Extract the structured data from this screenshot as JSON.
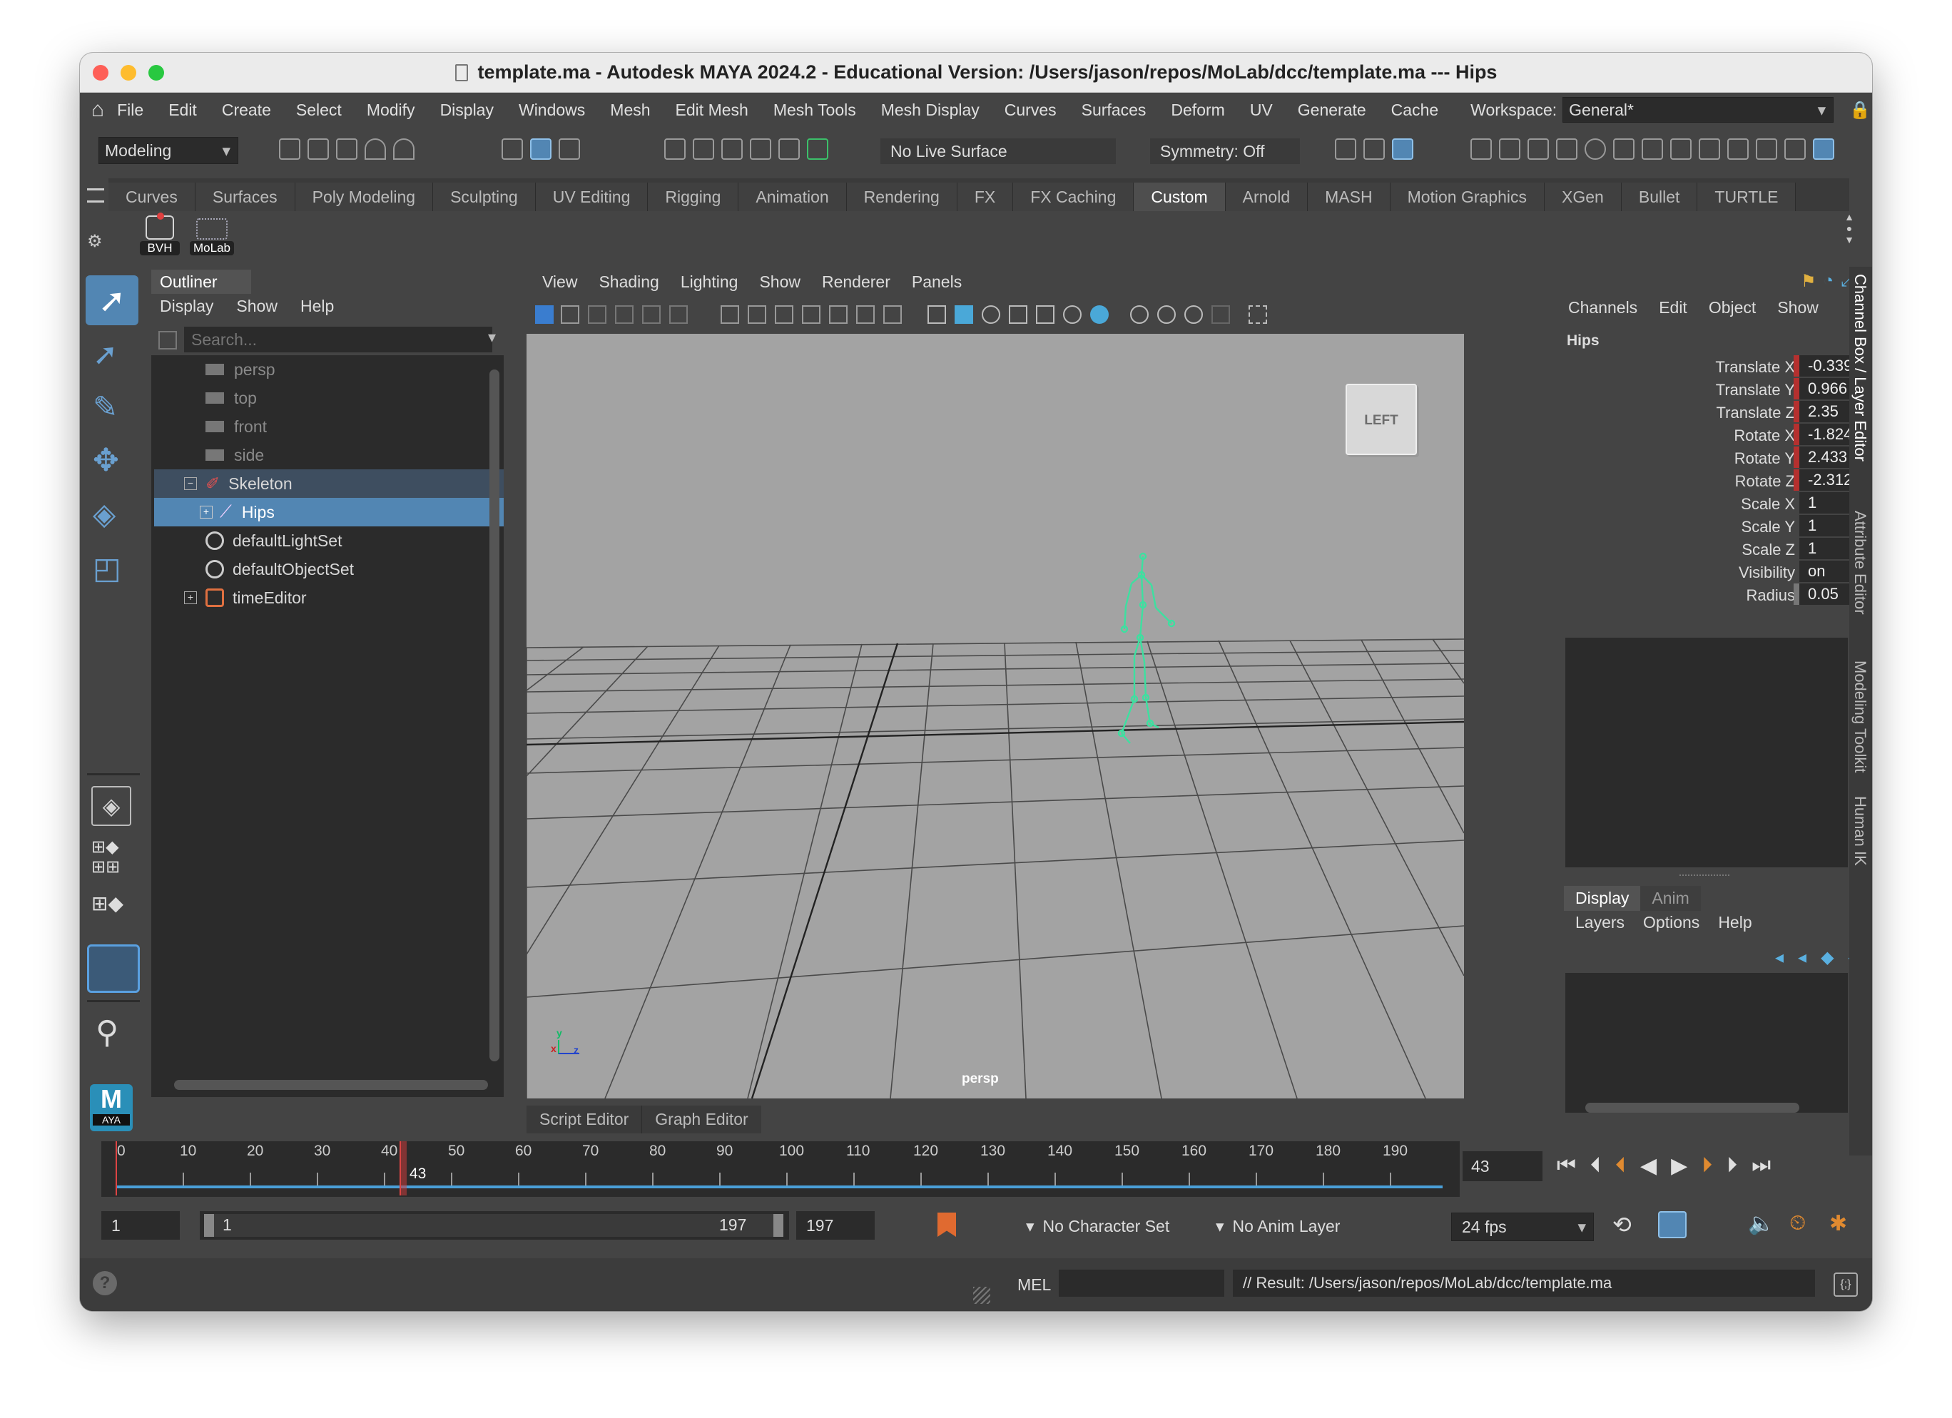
{
  "window": {
    "title": "template.ma - Autodesk MAYA 2024.2 - Educational Version: /Users/jason/repos/MoLab/dcc/template.ma   ---   Hips"
  },
  "menubar": {
    "items": [
      "File",
      "Edit",
      "Create",
      "Select",
      "Modify",
      "Display",
      "Windows",
      "Mesh",
      "Edit Mesh",
      "Mesh Tools",
      "Mesh Display",
      "Curves",
      "Surfaces",
      "Deform",
      "UV",
      "Generate",
      "Cache"
    ],
    "workspace_label": "Workspace:",
    "workspace_value": "General*"
  },
  "statusline": {
    "mode": "Modeling",
    "live_surface": "No Live Surface",
    "symmetry": "Symmetry: Off"
  },
  "shelf": {
    "tabs": [
      "Curves",
      "Surfaces",
      "Poly Modeling",
      "Sculpting",
      "UV Editing",
      "Rigging",
      "Animation",
      "Rendering",
      "FX",
      "FX Caching",
      "Custom",
      "Arnold",
      "MASH",
      "Motion Graphics",
      "XGen",
      "Bullet",
      "TURTLE"
    ],
    "active_tab": "Custom",
    "buttons": [
      "BVH",
      "MoLab"
    ]
  },
  "outliner": {
    "title": "Outliner",
    "menu": [
      "Display",
      "Show",
      "Help"
    ],
    "search_placeholder": "Search...",
    "items": [
      {
        "label": "persp",
        "icon": "camera-icon",
        "dim": true,
        "selected": false
      },
      {
        "label": "top",
        "icon": "camera-icon",
        "dim": true,
        "selected": false
      },
      {
        "label": "front",
        "icon": "camera-icon",
        "dim": true,
        "selected": false
      },
      {
        "label": "side",
        "icon": "camera-icon",
        "dim": true,
        "selected": false
      },
      {
        "label": "Skeleton",
        "icon": "joint-group-icon",
        "dim": false,
        "selected": "parent"
      },
      {
        "label": "Hips",
        "icon": "joint-icon",
        "dim": false,
        "selected": true
      },
      {
        "label": "defaultLightSet",
        "icon": "set-icon",
        "dim": false,
        "selected": false
      },
      {
        "label": "defaultObjectSet",
        "icon": "set-icon",
        "dim": false,
        "selected": false
      },
      {
        "label": "timeEditor",
        "icon": "time-editor-icon",
        "dim": false,
        "selected": false
      }
    ]
  },
  "viewport": {
    "menu": [
      "View",
      "Shading",
      "Lighting",
      "Show",
      "Renderer",
      "Panels"
    ],
    "view_cube": "LEFT",
    "camera": "persp",
    "bottom_tabs": [
      "Script Editor",
      "Graph Editor"
    ]
  },
  "channelbox": {
    "menu": [
      "Channels",
      "Edit",
      "Object",
      "Show"
    ],
    "node": "Hips",
    "channels": [
      {
        "label": "Translate X",
        "value": "-0.339",
        "keyed": true
      },
      {
        "label": "Translate Y",
        "value": "0.966",
        "keyed": true
      },
      {
        "label": "Translate Z",
        "value": "2.35",
        "keyed": true
      },
      {
        "label": "Rotate X",
        "value": "-1.824",
        "keyed": true
      },
      {
        "label": "Rotate Y",
        "value": "2.433",
        "keyed": true
      },
      {
        "label": "Rotate Z",
        "value": "-2.312",
        "keyed": true
      },
      {
        "label": "Scale X",
        "value": "1",
        "keyed": false
      },
      {
        "label": "Scale Y",
        "value": "1",
        "keyed": false
      },
      {
        "label": "Scale Z",
        "value": "1",
        "keyed": false
      },
      {
        "label": "Visibility",
        "value": "on",
        "keyed": false
      },
      {
        "label": "Radius",
        "value": "0.05",
        "keyed": "grey"
      }
    ],
    "layer_tabs": [
      "Display",
      "Anim"
    ],
    "layer_menu": [
      "Layers",
      "Options",
      "Help"
    ],
    "side_tabs": [
      "Channel Box / Layer Editor",
      "Attribute Editor",
      "Modeling Toolkit",
      "Human IK"
    ]
  },
  "timeline": {
    "ticks": [
      "0",
      "10",
      "20",
      "30",
      "40",
      "50",
      "60",
      "70",
      "80",
      "90",
      "100",
      "110",
      "120",
      "130",
      "140",
      "150",
      "160",
      "170",
      "180",
      "190"
    ],
    "current_frame": "43",
    "frame_field": "43"
  },
  "range": {
    "start": "1",
    "slider_start": "1",
    "slider_end": "197",
    "end": "197",
    "character_set": "No Character Set",
    "anim_layer": "No Anim Layer",
    "fps": "24 fps"
  },
  "commandline": {
    "language": "MEL",
    "result": "// Result: /Users/jason/repos/MoLab/dcc/template.ma"
  },
  "logo": {
    "letter": "M",
    "sub": "AYA"
  }
}
